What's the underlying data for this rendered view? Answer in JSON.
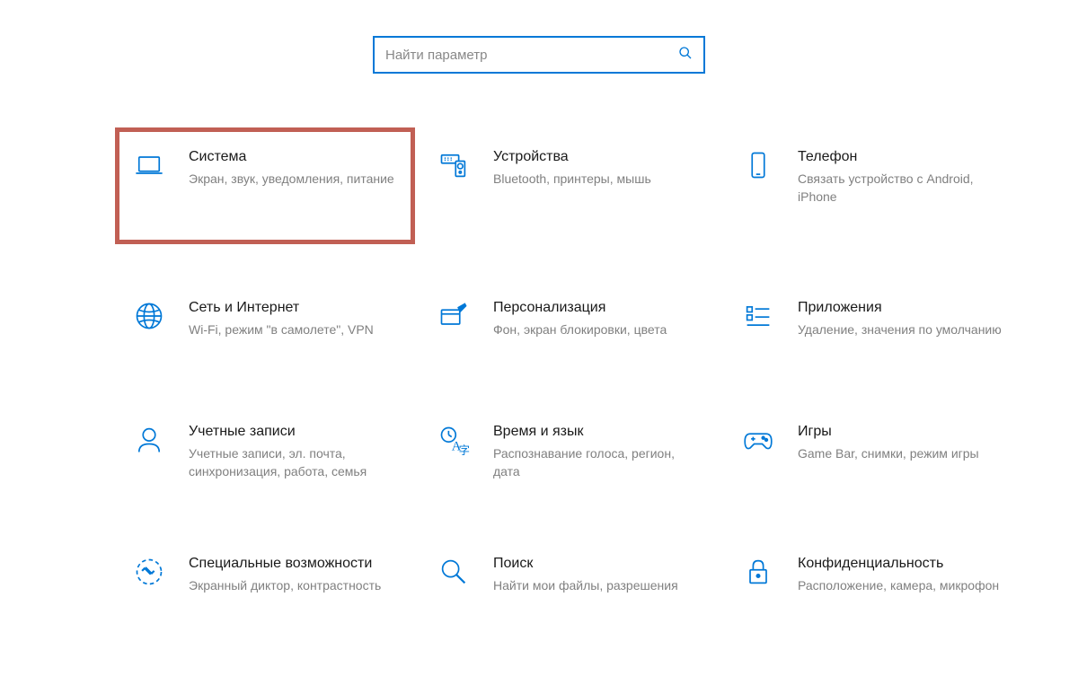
{
  "search": {
    "placeholder": "Найти параметр"
  },
  "categories": [
    {
      "id": "system",
      "title": "Система",
      "desc": "Экран, звук, уведомления, питание",
      "highlighted": true
    },
    {
      "id": "devices",
      "title": "Устройства",
      "desc": "Bluetooth, принтеры, мышь",
      "highlighted": false
    },
    {
      "id": "phone",
      "title": "Телефон",
      "desc": "Связать устройство с Android, iPhone",
      "highlighted": false
    },
    {
      "id": "network",
      "title": "Сеть и Интернет",
      "desc": "Wi-Fi, режим \"в самолете\", VPN",
      "highlighted": false
    },
    {
      "id": "personalization",
      "title": "Персонализация",
      "desc": "Фон, экран блокировки, цвета",
      "highlighted": false
    },
    {
      "id": "apps",
      "title": "Приложения",
      "desc": "Удаление, значения по умолчанию",
      "highlighted": false
    },
    {
      "id": "accounts",
      "title": "Учетные записи",
      "desc": "Учетные записи, эл. почта, синхронизация, работа, семья",
      "highlighted": false
    },
    {
      "id": "time-language",
      "title": "Время и язык",
      "desc": "Распознавание голоса, регион, дата",
      "highlighted": false
    },
    {
      "id": "gaming",
      "title": "Игры",
      "desc": "Game Bar, снимки, режим игры",
      "highlighted": false
    },
    {
      "id": "accessibility",
      "title": "Специальные возможности",
      "desc": "Экранный диктор, контрастность",
      "highlighted": false
    },
    {
      "id": "search-cat",
      "title": "Поиск",
      "desc": "Найти мои файлы, разрешения",
      "highlighted": false
    },
    {
      "id": "privacy",
      "title": "Конфиденциальность",
      "desc": "Расположение, камера, микрофон",
      "highlighted": false
    }
  ]
}
